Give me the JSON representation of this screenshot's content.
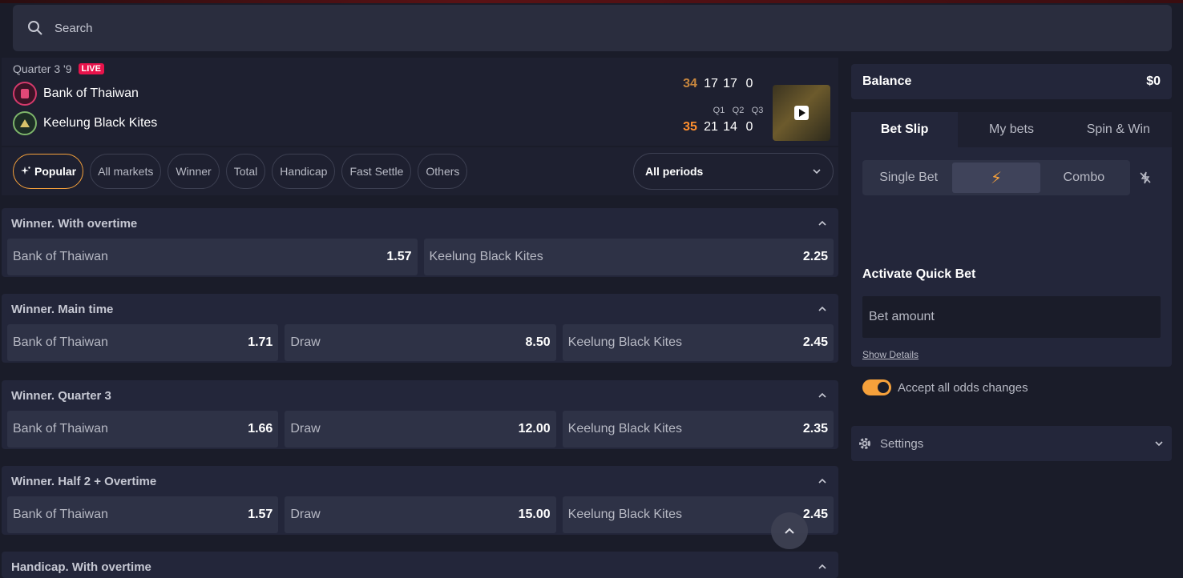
{
  "search": {
    "placeholder": "Search"
  },
  "match": {
    "period_text": "Quarter 3 '9",
    "live_label": "LIVE",
    "home": {
      "name": "Bank of Thaiwan",
      "total": "34",
      "q1": "17",
      "q2": "17",
      "q3": "0"
    },
    "away": {
      "name": "Keelung Black Kites",
      "total": "35",
      "q1": "21",
      "q2": "14",
      "q3": "0"
    },
    "quarter_labels": [
      "Q1",
      "Q2",
      "Q3"
    ]
  },
  "filters": {
    "chips": [
      "Popular",
      "All markets",
      "Winner",
      "Total",
      "Handicap",
      "Fast Settle",
      "Others"
    ],
    "period": "All periods"
  },
  "markets": [
    {
      "title": "Winner. With overtime",
      "outcomes": [
        {
          "label": "Bank of Thaiwan",
          "odd": "1.57"
        },
        {
          "label": "Keelung Black Kites",
          "odd": "2.25"
        }
      ]
    },
    {
      "title": "Winner. Main time",
      "outcomes": [
        {
          "label": "Bank of Thaiwan",
          "odd": "1.71"
        },
        {
          "label": "Draw",
          "odd": "8.50"
        },
        {
          "label": "Keelung Black Kites",
          "odd": "2.45"
        }
      ]
    },
    {
      "title": "Winner. Quarter 3",
      "outcomes": [
        {
          "label": "Bank of Thaiwan",
          "odd": "1.66"
        },
        {
          "label": "Draw",
          "odd": "12.00"
        },
        {
          "label": "Keelung Black Kites",
          "odd": "2.35"
        }
      ]
    },
    {
      "title": "Winner. Half 2 + Overtime",
      "outcomes": [
        {
          "label": "Bank of Thaiwan",
          "odd": "1.57"
        },
        {
          "label": "Draw",
          "odd": "15.00"
        },
        {
          "label": "Keelung Black Kites",
          "odd": "2.45"
        }
      ]
    },
    {
      "title": "Handicap. With overtime",
      "outcomes": []
    }
  ],
  "balance": {
    "label": "Balance",
    "value": "$0"
  },
  "betslip": {
    "tabs": [
      "Bet Slip",
      "My bets",
      "Spin & Win"
    ],
    "modes": [
      "Single Bet",
      "⚡",
      "Combo"
    ],
    "quick_bet_title": "Activate Quick Bet",
    "amount_placeholder": "Bet amount",
    "show_details": "Show Details",
    "accept_label": "Accept all odds changes",
    "accept_enabled": true
  },
  "settings": {
    "label": "Settings"
  },
  "colors": {
    "accent": "#f6a13b",
    "live": "#e8134b",
    "background": "#1a1c29",
    "panel": "#23263a"
  }
}
